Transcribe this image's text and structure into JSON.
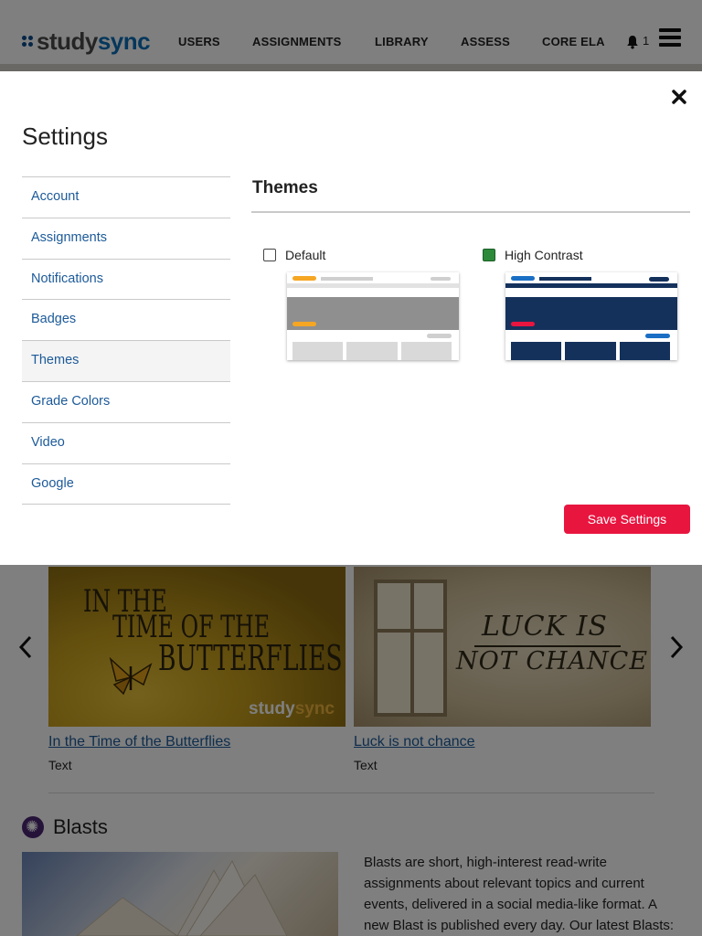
{
  "header": {
    "logo_part1": "study",
    "logo_part2": "sync",
    "nav": [
      "USERS",
      "ASSIGNMENTS",
      "LIBRARY",
      "ASSESS",
      "CORE ELA"
    ],
    "notification_count": "1",
    "bell_icon": "bell-icon",
    "menu_icon": "hamburger-menu-icon"
  },
  "modal": {
    "title": "Settings",
    "close_icon": "close-icon",
    "menu_items": [
      "Account",
      "Assignments",
      "Notifications",
      "Badges",
      "Themes",
      "Grade Colors",
      "Video",
      "Google"
    ],
    "active_item": "Themes",
    "section_title": "Themes",
    "themes": [
      {
        "label": "Default",
        "checked": false
      },
      {
        "label": "High Contrast",
        "checked": true
      }
    ],
    "save_label": "Save Settings"
  },
  "background": {
    "cards": [
      {
        "art_lines": [
          "IN THE",
          "TIME OF THE",
          "BUTTERFLIES"
        ],
        "brand_part1": "study",
        "brand_part2": "sync",
        "link": "In the Time of the Butterflies",
        "type": "Text"
      },
      {
        "art_lines": [
          "LUCK IS",
          "NOT CHANCE"
        ],
        "link": "Luck is not chance",
        "type": "Text"
      }
    ],
    "blasts_heading": "Blasts",
    "blasts_description": "Blasts are short, high-interest read-write assignments about relevant topics and current events, delivered in a social media-like format. A new Blast is published every day. Our latest Blasts:"
  },
  "colors": {
    "link": "#1c5a99",
    "save_button": "#e8153f",
    "checked_box": "#2c8a3a",
    "high_contrast_navy": "#14315c",
    "default_orange": "#f5a623"
  }
}
